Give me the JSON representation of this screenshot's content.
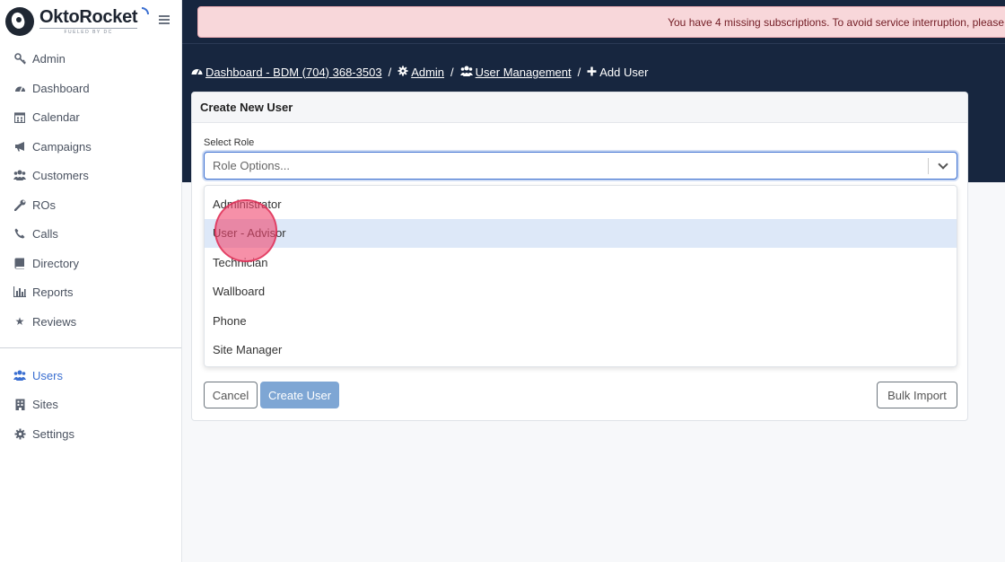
{
  "brand": {
    "name": "OktoRocket",
    "tagline": "FUELED BY DC"
  },
  "sidebar": {
    "items": [
      {
        "label": "Admin",
        "icon": "key-icon"
      },
      {
        "label": "Dashboard",
        "icon": "tachometer-icon"
      },
      {
        "label": "Calendar",
        "icon": "calendar-icon"
      },
      {
        "label": "Campaigns",
        "icon": "bullhorn-icon"
      },
      {
        "label": "Customers",
        "icon": "users-icon"
      },
      {
        "label": "ROs",
        "icon": "wrench-icon"
      },
      {
        "label": "Calls",
        "icon": "phone-icon"
      },
      {
        "label": "Directory",
        "icon": "book-icon"
      },
      {
        "label": "Reports",
        "icon": "bar-chart-icon"
      },
      {
        "label": "Reviews",
        "icon": "star-icon"
      }
    ],
    "secondary": [
      {
        "label": "Users",
        "icon": "users-icon",
        "active": true
      },
      {
        "label": "Sites",
        "icon": "building-icon"
      },
      {
        "label": "Settings",
        "icon": "gear-icon"
      }
    ]
  },
  "alert": {
    "text": "You have 4 missing subscriptions. To avoid service interruption, please"
  },
  "breadcrumb": {
    "dashboard": "Dashboard - BDM (704) 368-3503",
    "admin": "Admin",
    "user_management": "User Management",
    "current": "Add User",
    "separator": "/"
  },
  "card": {
    "title": "Create New User",
    "select_label": "Select Role",
    "select_placeholder": "Role Options...",
    "options": [
      "Administrator",
      "User - Advisor",
      "Technician",
      "Wallboard",
      "Phone",
      "Site Manager"
    ],
    "highlighted_option": "User - Advisor",
    "cancel_label": "Cancel",
    "create_label": "Create User",
    "bulk_label": "Bulk Import"
  },
  "colors": {
    "header_bg": "#17263f",
    "accent": "#3b6fd1",
    "alert_bg": "#f8d7da",
    "alert_text": "#721c24",
    "create_button": "#7ea6d4",
    "highlight_option": "#dde8f8",
    "cursor_marker": "#f0466e"
  }
}
